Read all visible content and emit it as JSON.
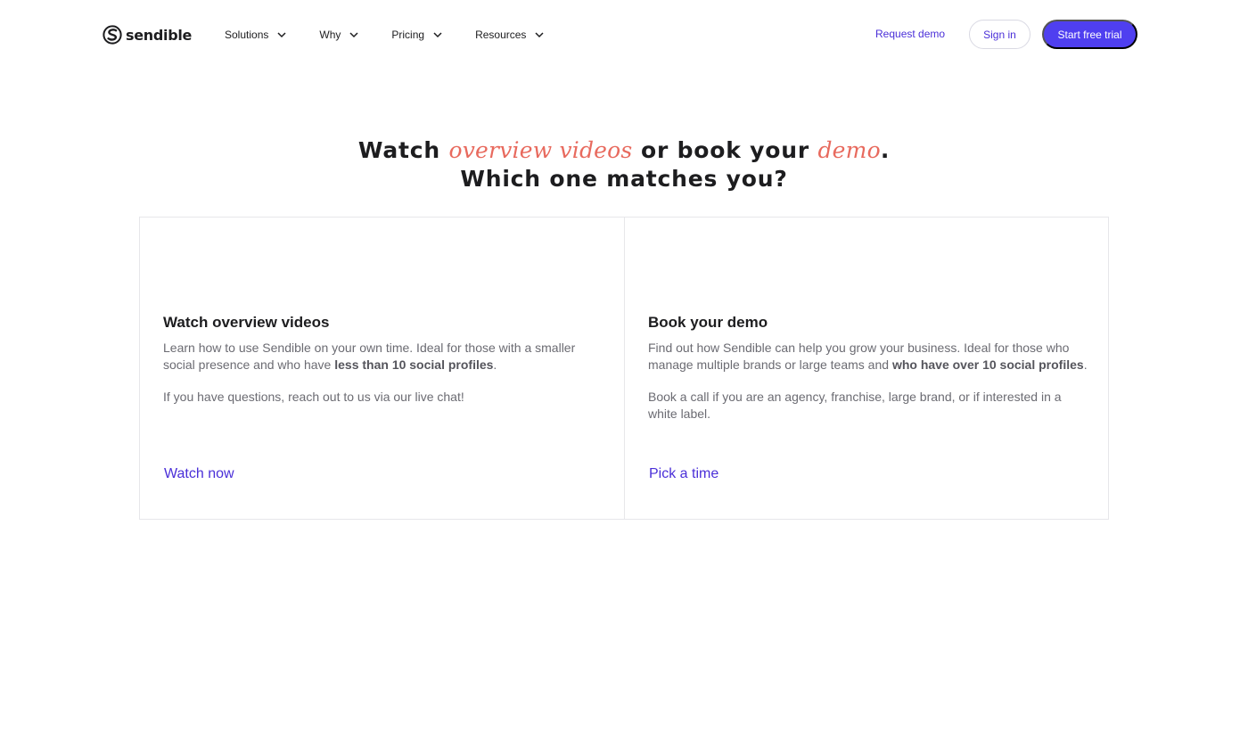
{
  "brand": {
    "name": "sendible",
    "logo_icon": "sendible-s-logo-icon"
  },
  "nav": {
    "items": [
      {
        "label": "Solutions",
        "icon": "chevron-down-icon"
      },
      {
        "label": "Why",
        "icon": "chevron-down-icon"
      },
      {
        "label": "Pricing",
        "icon": "chevron-down-icon"
      },
      {
        "label": "Resources",
        "icon": "chevron-down-icon"
      }
    ]
  },
  "header_actions": {
    "request_demo": "Request demo",
    "sign_in": "Sign in",
    "start_trial": "Start free trial"
  },
  "headline": {
    "line1_part1": "Watch ",
    "line1_accent1": "overview videos",
    "line1_part2": " or book your ",
    "line1_accent2": "demo",
    "line1_part3": ".",
    "line2": "Which one matches you?"
  },
  "cards": [
    {
      "title": "Watch overview videos",
      "body_p1_text": "Learn how to use Sendible on your own time. Ideal for those with a smaller social presence and who have ",
      "body_p1_bold": "less than 10 social profiles",
      "body_p1_end": ".",
      "body_p2": "If you have questions, reach out to us via our live chat!",
      "link": "Watch now"
    },
    {
      "title": "Book your demo",
      "body_p1_text": "Find out how Sendible can help you grow your business. Ideal for those who manage multiple brands or large teams and ",
      "body_p1_bold": "who have over 10 social profiles",
      "body_p1_end": ".",
      "body_p2": "Book a call if you are an agency, franchise, large brand, or if interested in a white label.",
      "link": "Pick a time"
    }
  ],
  "colors": {
    "accent_purple": "#4f3ff0",
    "link_purple": "#4a2fd8",
    "accent_coral": "#e86a5e",
    "text_dark": "#1d1d1f",
    "text_muted": "#6b6b72"
  }
}
